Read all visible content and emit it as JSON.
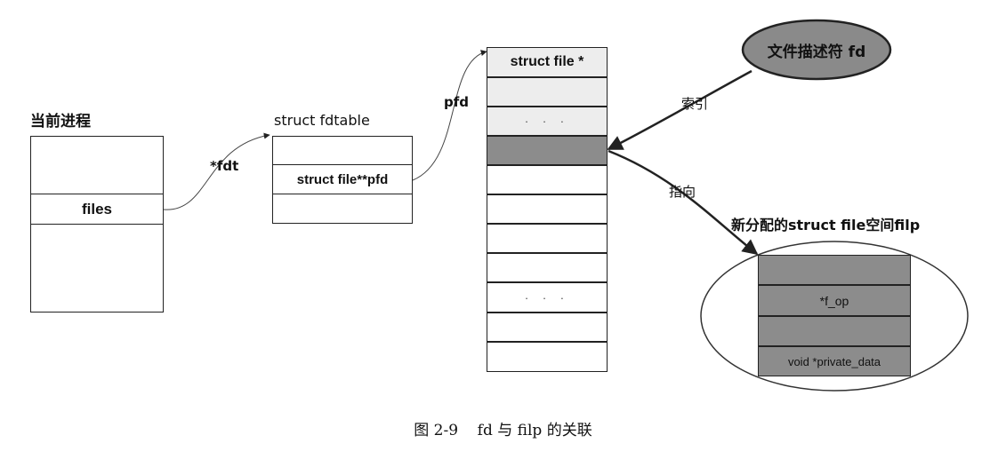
{
  "process": {
    "title": "当前进程",
    "files_label": "files"
  },
  "fdt_label": "*fdt",
  "fdtable": {
    "title": "struct fdtable",
    "pfd_field": "struct file**pfd"
  },
  "pfd_label": "pfd",
  "pfd_array": {
    "header": "struct file *",
    "dots_top": "· · ·",
    "dots_mid": "· · ·"
  },
  "fd_ellipse": {
    "label": "文件描述符 fd"
  },
  "index_label": "索引",
  "point_label": "指向",
  "filp": {
    "title": "新分配的struct file空间filp",
    "fields": [
      "",
      "*f_op",
      "",
      "void *private_data"
    ]
  },
  "caption": "图 2-9    fd 与 filp 的关联",
  "colors": {
    "highlight": "#8c8c8c",
    "ellipse_fill": "#8a8a8a",
    "line": "#222222"
  }
}
